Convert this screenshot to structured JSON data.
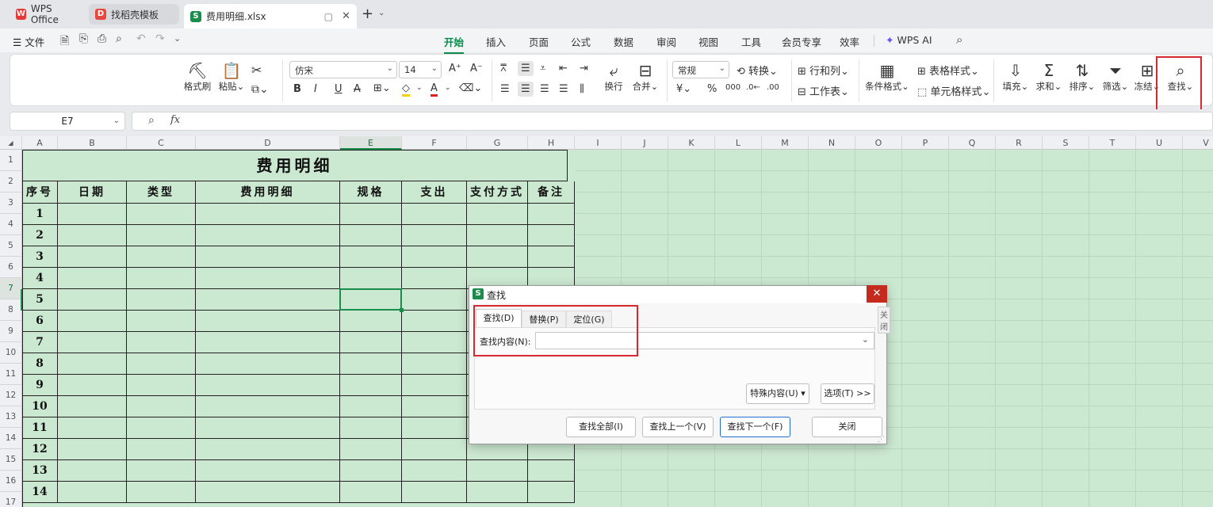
{
  "tabs": [
    {
      "label": "WPS Office",
      "icon": "wps-logo-icon"
    },
    {
      "label": "找稻壳模板",
      "icon": "docer-icon"
    },
    {
      "label": "费用明细.xlsx",
      "icon": "sheet-icon"
    }
  ],
  "menu": {
    "file": "文件",
    "tabs": [
      "开始",
      "插入",
      "页面",
      "公式",
      "数据",
      "审阅",
      "视图",
      "工具",
      "会员专享",
      "效率"
    ],
    "ai": "WPS AI"
  },
  "ribbon": {
    "format_painter": "格式刷",
    "paste": "粘贴",
    "font": "仿宋",
    "size": "14",
    "wrap": "换行",
    "merge": "合并",
    "number_format": "常规",
    "convert": "转换",
    "rows_cols": "行和列",
    "worksheet": "工作表",
    "cond_format": "条件格式",
    "table_style": "表格样式",
    "cell_style": "单元格样式",
    "fill": "填充",
    "sum": "求和",
    "sort": "排序",
    "filter": "筛选",
    "freeze": "冻结",
    "find": "查找"
  },
  "namebox": "E7",
  "sheet": {
    "columns": [
      "A",
      "B",
      "C",
      "D",
      "E",
      "F",
      "G",
      "H",
      "I",
      "J",
      "K",
      "L",
      "M",
      "N",
      "O",
      "P",
      "Q",
      "R",
      "S",
      "T",
      "U",
      "V"
    ],
    "title": "费用明细",
    "headers": [
      "序号",
      "日期",
      "类型",
      "费用明细",
      "规格",
      "支出",
      "支付方式",
      "备注"
    ],
    "rows": [
      "1",
      "2",
      "3",
      "4",
      "5",
      "6",
      "7",
      "8",
      "9",
      "10",
      "11",
      "12",
      "13",
      "14"
    ]
  },
  "dialog": {
    "title": "查找",
    "close_tooltip": "关闭",
    "tabs": [
      "查找(D)",
      "替换(P)",
      "定位(G)"
    ],
    "find_label": "查找内容(N):",
    "find_value": "",
    "special": "特殊内容(U)",
    "options": "选项(T) >>",
    "find_all": "查找全部(I)",
    "find_prev": "查找上一个(V)",
    "find_next": "查找下一个(F)",
    "close_btn": "关闭"
  },
  "colors": {
    "accent": "#0a8a4a",
    "sheet_bg": "#cbe8d1",
    "highlight": "#d7282f"
  }
}
